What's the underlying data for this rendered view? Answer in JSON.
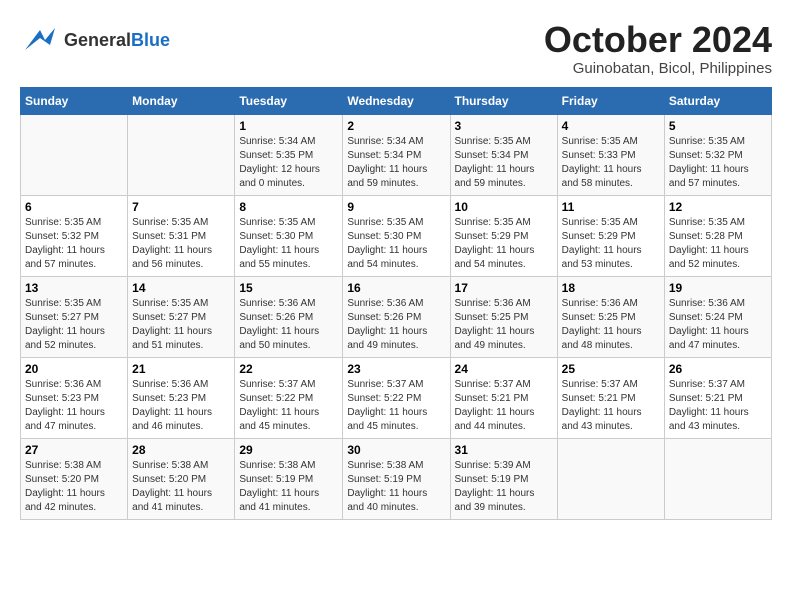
{
  "header": {
    "logo_line1": "General",
    "logo_line2": "Blue",
    "title": "October 2024",
    "subtitle": "Guinobatan, Bicol, Philippines"
  },
  "days_of_week": [
    "Sunday",
    "Monday",
    "Tuesday",
    "Wednesday",
    "Thursday",
    "Friday",
    "Saturday"
  ],
  "weeks": [
    [
      {
        "num": "",
        "info": ""
      },
      {
        "num": "",
        "info": ""
      },
      {
        "num": "1",
        "info": "Sunrise: 5:34 AM\nSunset: 5:35 PM\nDaylight: 12 hours\nand 0 minutes."
      },
      {
        "num": "2",
        "info": "Sunrise: 5:34 AM\nSunset: 5:34 PM\nDaylight: 11 hours\nand 59 minutes."
      },
      {
        "num": "3",
        "info": "Sunrise: 5:35 AM\nSunset: 5:34 PM\nDaylight: 11 hours\nand 59 minutes."
      },
      {
        "num": "4",
        "info": "Sunrise: 5:35 AM\nSunset: 5:33 PM\nDaylight: 11 hours\nand 58 minutes."
      },
      {
        "num": "5",
        "info": "Sunrise: 5:35 AM\nSunset: 5:32 PM\nDaylight: 11 hours\nand 57 minutes."
      }
    ],
    [
      {
        "num": "6",
        "info": "Sunrise: 5:35 AM\nSunset: 5:32 PM\nDaylight: 11 hours\nand 57 minutes."
      },
      {
        "num": "7",
        "info": "Sunrise: 5:35 AM\nSunset: 5:31 PM\nDaylight: 11 hours\nand 56 minutes."
      },
      {
        "num": "8",
        "info": "Sunrise: 5:35 AM\nSunset: 5:30 PM\nDaylight: 11 hours\nand 55 minutes."
      },
      {
        "num": "9",
        "info": "Sunrise: 5:35 AM\nSunset: 5:30 PM\nDaylight: 11 hours\nand 54 minutes."
      },
      {
        "num": "10",
        "info": "Sunrise: 5:35 AM\nSunset: 5:29 PM\nDaylight: 11 hours\nand 54 minutes."
      },
      {
        "num": "11",
        "info": "Sunrise: 5:35 AM\nSunset: 5:29 PM\nDaylight: 11 hours\nand 53 minutes."
      },
      {
        "num": "12",
        "info": "Sunrise: 5:35 AM\nSunset: 5:28 PM\nDaylight: 11 hours\nand 52 minutes."
      }
    ],
    [
      {
        "num": "13",
        "info": "Sunrise: 5:35 AM\nSunset: 5:27 PM\nDaylight: 11 hours\nand 52 minutes."
      },
      {
        "num": "14",
        "info": "Sunrise: 5:35 AM\nSunset: 5:27 PM\nDaylight: 11 hours\nand 51 minutes."
      },
      {
        "num": "15",
        "info": "Sunrise: 5:36 AM\nSunset: 5:26 PM\nDaylight: 11 hours\nand 50 minutes."
      },
      {
        "num": "16",
        "info": "Sunrise: 5:36 AM\nSunset: 5:26 PM\nDaylight: 11 hours\nand 49 minutes."
      },
      {
        "num": "17",
        "info": "Sunrise: 5:36 AM\nSunset: 5:25 PM\nDaylight: 11 hours\nand 49 minutes."
      },
      {
        "num": "18",
        "info": "Sunrise: 5:36 AM\nSunset: 5:25 PM\nDaylight: 11 hours\nand 48 minutes."
      },
      {
        "num": "19",
        "info": "Sunrise: 5:36 AM\nSunset: 5:24 PM\nDaylight: 11 hours\nand 47 minutes."
      }
    ],
    [
      {
        "num": "20",
        "info": "Sunrise: 5:36 AM\nSunset: 5:23 PM\nDaylight: 11 hours\nand 47 minutes."
      },
      {
        "num": "21",
        "info": "Sunrise: 5:36 AM\nSunset: 5:23 PM\nDaylight: 11 hours\nand 46 minutes."
      },
      {
        "num": "22",
        "info": "Sunrise: 5:37 AM\nSunset: 5:22 PM\nDaylight: 11 hours\nand 45 minutes."
      },
      {
        "num": "23",
        "info": "Sunrise: 5:37 AM\nSunset: 5:22 PM\nDaylight: 11 hours\nand 45 minutes."
      },
      {
        "num": "24",
        "info": "Sunrise: 5:37 AM\nSunset: 5:21 PM\nDaylight: 11 hours\nand 44 minutes."
      },
      {
        "num": "25",
        "info": "Sunrise: 5:37 AM\nSunset: 5:21 PM\nDaylight: 11 hours\nand 43 minutes."
      },
      {
        "num": "26",
        "info": "Sunrise: 5:37 AM\nSunset: 5:21 PM\nDaylight: 11 hours\nand 43 minutes."
      }
    ],
    [
      {
        "num": "27",
        "info": "Sunrise: 5:38 AM\nSunset: 5:20 PM\nDaylight: 11 hours\nand 42 minutes."
      },
      {
        "num": "28",
        "info": "Sunrise: 5:38 AM\nSunset: 5:20 PM\nDaylight: 11 hours\nand 41 minutes."
      },
      {
        "num": "29",
        "info": "Sunrise: 5:38 AM\nSunset: 5:19 PM\nDaylight: 11 hours\nand 41 minutes."
      },
      {
        "num": "30",
        "info": "Sunrise: 5:38 AM\nSunset: 5:19 PM\nDaylight: 11 hours\nand 40 minutes."
      },
      {
        "num": "31",
        "info": "Sunrise: 5:39 AM\nSunset: 5:19 PM\nDaylight: 11 hours\nand 39 minutes."
      },
      {
        "num": "",
        "info": ""
      },
      {
        "num": "",
        "info": ""
      }
    ]
  ]
}
